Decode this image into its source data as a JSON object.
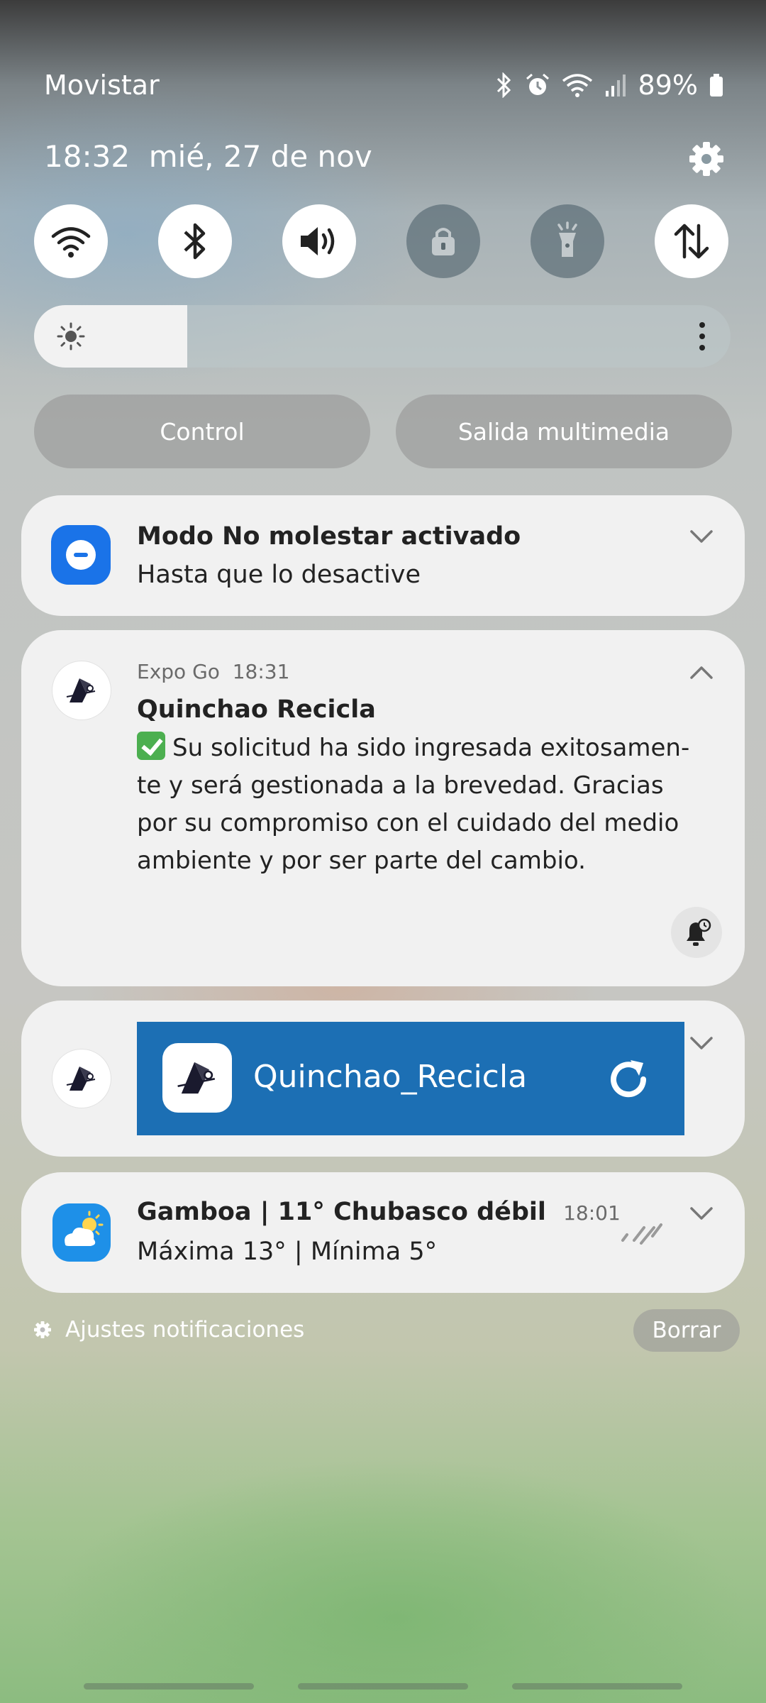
{
  "status_bar": {
    "carrier": "Movistar",
    "battery": "89%",
    "icons": [
      "bluetooth-icon",
      "alarm-icon",
      "wifi-icon",
      "signal-icon",
      "battery-icon"
    ]
  },
  "header": {
    "time": "18:32",
    "date": "mié, 27 de nov",
    "settings_icon": "gear-icon"
  },
  "quick_settings": [
    {
      "name": "wifi",
      "icon": "wifi-icon",
      "state": "on"
    },
    {
      "name": "bluetooth",
      "icon": "bluetooth-icon",
      "state": "on"
    },
    {
      "name": "sound",
      "icon": "volume-icon",
      "state": "on"
    },
    {
      "name": "rotation-lock",
      "icon": "lock-icon",
      "state": "off"
    },
    {
      "name": "flashlight",
      "icon": "flashlight-icon",
      "state": "off"
    },
    {
      "name": "mobile-data",
      "icon": "data-transfer-icon",
      "state": "on"
    }
  ],
  "brightness": {
    "level": 0.22,
    "icon": "sun-icon"
  },
  "pills": {
    "control": "Control",
    "media_output": "Salida multimedia"
  },
  "notifications": {
    "dnd": {
      "title": "Modo No molestar activado",
      "subtitle": "Hasta que lo desactive",
      "icon": "do-not-disturb-icon"
    },
    "expo": {
      "app": "Expo Go",
      "time": "18:31",
      "title": "Quinchao Recicla",
      "body": "Su solicitud ha sido ingresada exitosamen-\nte y será gestionada a la brevedad. Gracias\npor su compromiso con el cuidado del medio\nambiente y por ser parte del cambio.",
      "emoji": "check-mark-emoji"
    },
    "dev": {
      "banner_label": "Quinchao_Recicla"
    },
    "weather": {
      "title": "Gamboa | 11° Chubasco débil",
      "time": "18:01",
      "subtitle": "Máxima 13° | Mínima 5°",
      "icon": "weather-partly-cloudy-icon",
      "accent": "#1e90e8"
    }
  },
  "footer": {
    "settings_label": "Ajustes notificaciones",
    "clear_label": "Borrar"
  },
  "colors": {
    "banner": "#1c6fb4",
    "dnd_icon": "#1a73e8"
  }
}
